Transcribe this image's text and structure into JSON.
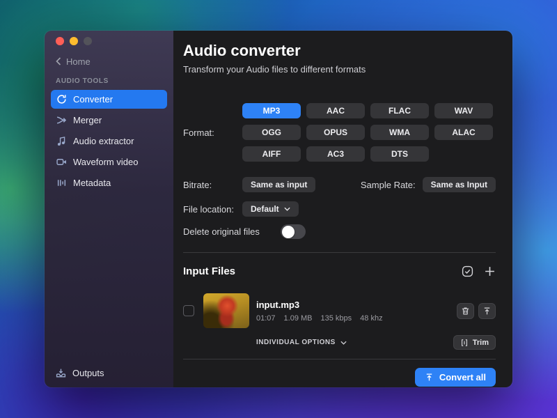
{
  "colors": {
    "accent": "#2e82f6",
    "traffic_close": "#ff5f57",
    "traffic_minimize": "#febc2e",
    "traffic_zoom_disabled": "#53535a"
  },
  "sidebar": {
    "back_label": "Home",
    "section_label": "AUDIO TOOLS",
    "items": [
      {
        "label": "Converter",
        "icon": "converter-icon",
        "selected": true
      },
      {
        "label": "Merger",
        "icon": "merger-icon",
        "selected": false
      },
      {
        "label": "Audio extractor",
        "icon": "music-note-icon",
        "selected": false
      },
      {
        "label": "Waveform video",
        "icon": "video-camera-icon",
        "selected": false
      },
      {
        "label": "Metadata",
        "icon": "metadata-bars-icon",
        "selected": false
      }
    ],
    "outputs_label": "Outputs",
    "outputs_icon": "outputs-tray-icon"
  },
  "header": {
    "title": "Audio converter",
    "subtitle": "Transform your Audio files to different formats"
  },
  "settings": {
    "format": {
      "label": "Format:",
      "selected": "MP3",
      "options": [
        "MP3",
        "AAC",
        "FLAC",
        "WAV",
        "OGG",
        "OPUS",
        "WMA",
        "ALAC",
        "AIFF",
        "AC3",
        "DTS"
      ]
    },
    "bitrate": {
      "label": "Bitrate:",
      "value": "Same as input"
    },
    "sample_rate": {
      "label": "Sample Rate:",
      "value": "Same as Input"
    },
    "file_location": {
      "label": "File location:",
      "value": "Default",
      "icon": "chevron-down-icon"
    },
    "delete_original": {
      "label": "Delete original files",
      "state": "off"
    }
  },
  "input_files": {
    "title": "Input Files",
    "header_icons": [
      "select-files-icon",
      "add-files-icon"
    ],
    "rows": [
      {
        "name": "input.mp3",
        "duration": "01:07",
        "size": "1.09 MB",
        "bitrate": "135 kbps",
        "sample_rate": "48 khz",
        "checked": false,
        "actions": [
          "trash-icon",
          "export-icon"
        ]
      }
    ],
    "individual_options_label": "INDIVIDUAL OPTIONS",
    "trim_label": "Trim",
    "trim_icon": "trim-icon"
  },
  "footer": {
    "convert_all_label": "Convert all",
    "convert_all_icon": "upload-arrow-icon"
  }
}
